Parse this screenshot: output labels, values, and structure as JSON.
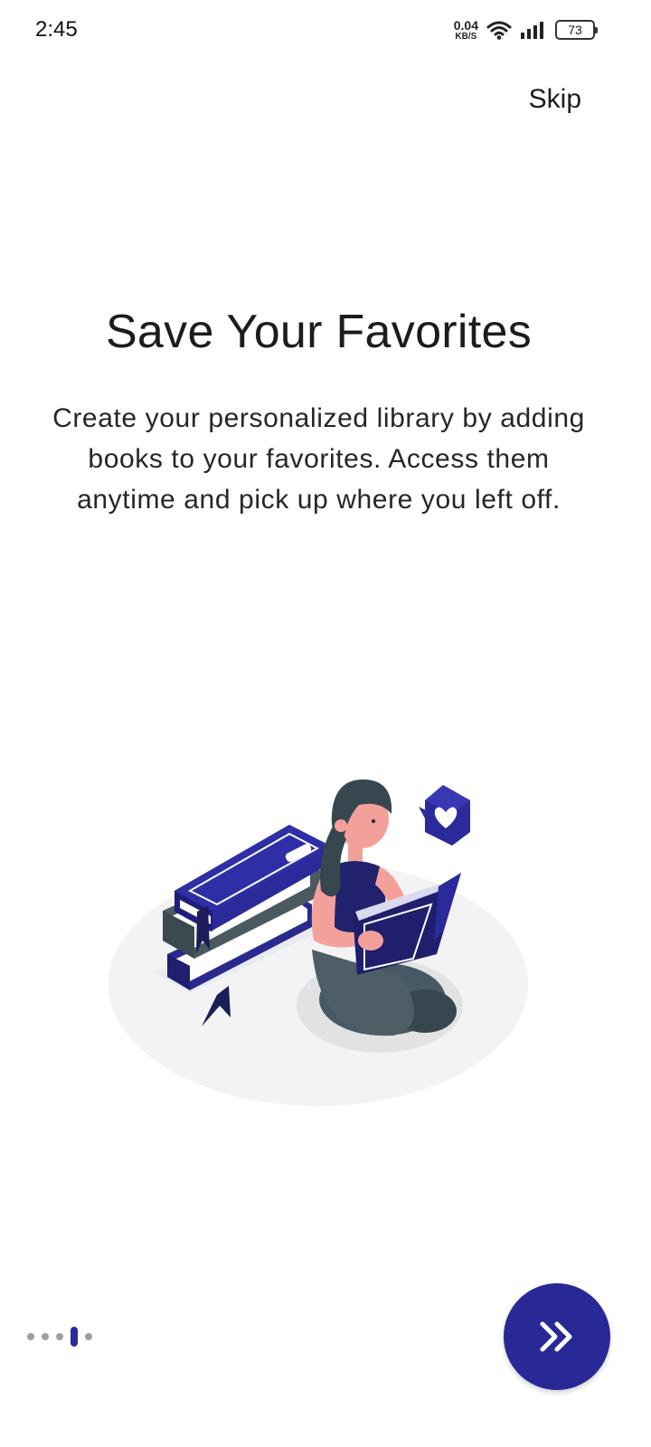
{
  "status_bar": {
    "time": "2:45",
    "net_speed_value": "0.04",
    "net_speed_unit": "KB/S",
    "battery_level": "73"
  },
  "header": {
    "skip_label": "Skip"
  },
  "onboarding": {
    "title": "Save Your Favorites",
    "description": "Create your personalized library by adding books to your favorites. Access them anytime and pick up where you left off.",
    "illustration_icon": "woman-reading-books-illustration"
  },
  "pager": {
    "total_pages": 5,
    "current_page": 4
  },
  "footer": {
    "next_icon": "double-chevron-right-icon"
  },
  "colors": {
    "accent": "#282896",
    "dot_inactive": "#9e9e9e",
    "text_primary": "#1c1c1c"
  }
}
